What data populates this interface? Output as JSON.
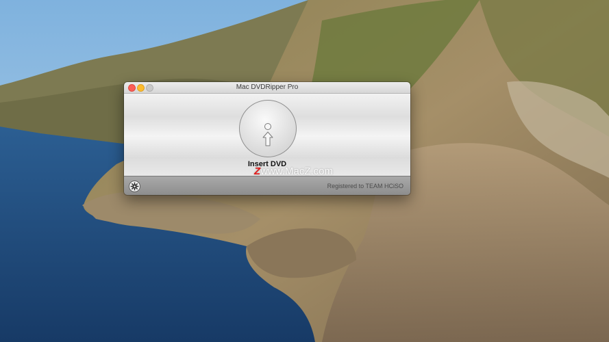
{
  "window": {
    "title": "Mac DVDRipper Pro"
  },
  "main": {
    "status_label": "Insert DVD",
    "disc_icon": "insert-dvd-disc-icon"
  },
  "watermark": {
    "z": "Z",
    "text": "www.MacZ.com"
  },
  "footer": {
    "registration": "Registered to TEAM HCiSO",
    "settings_icon": "gear-icon"
  },
  "colors": {
    "close": "#fc5f57",
    "minimize": "#fdbc2e",
    "zoom_disabled": "#c9c9c9",
    "footer_bar": "#9a9a9a"
  }
}
